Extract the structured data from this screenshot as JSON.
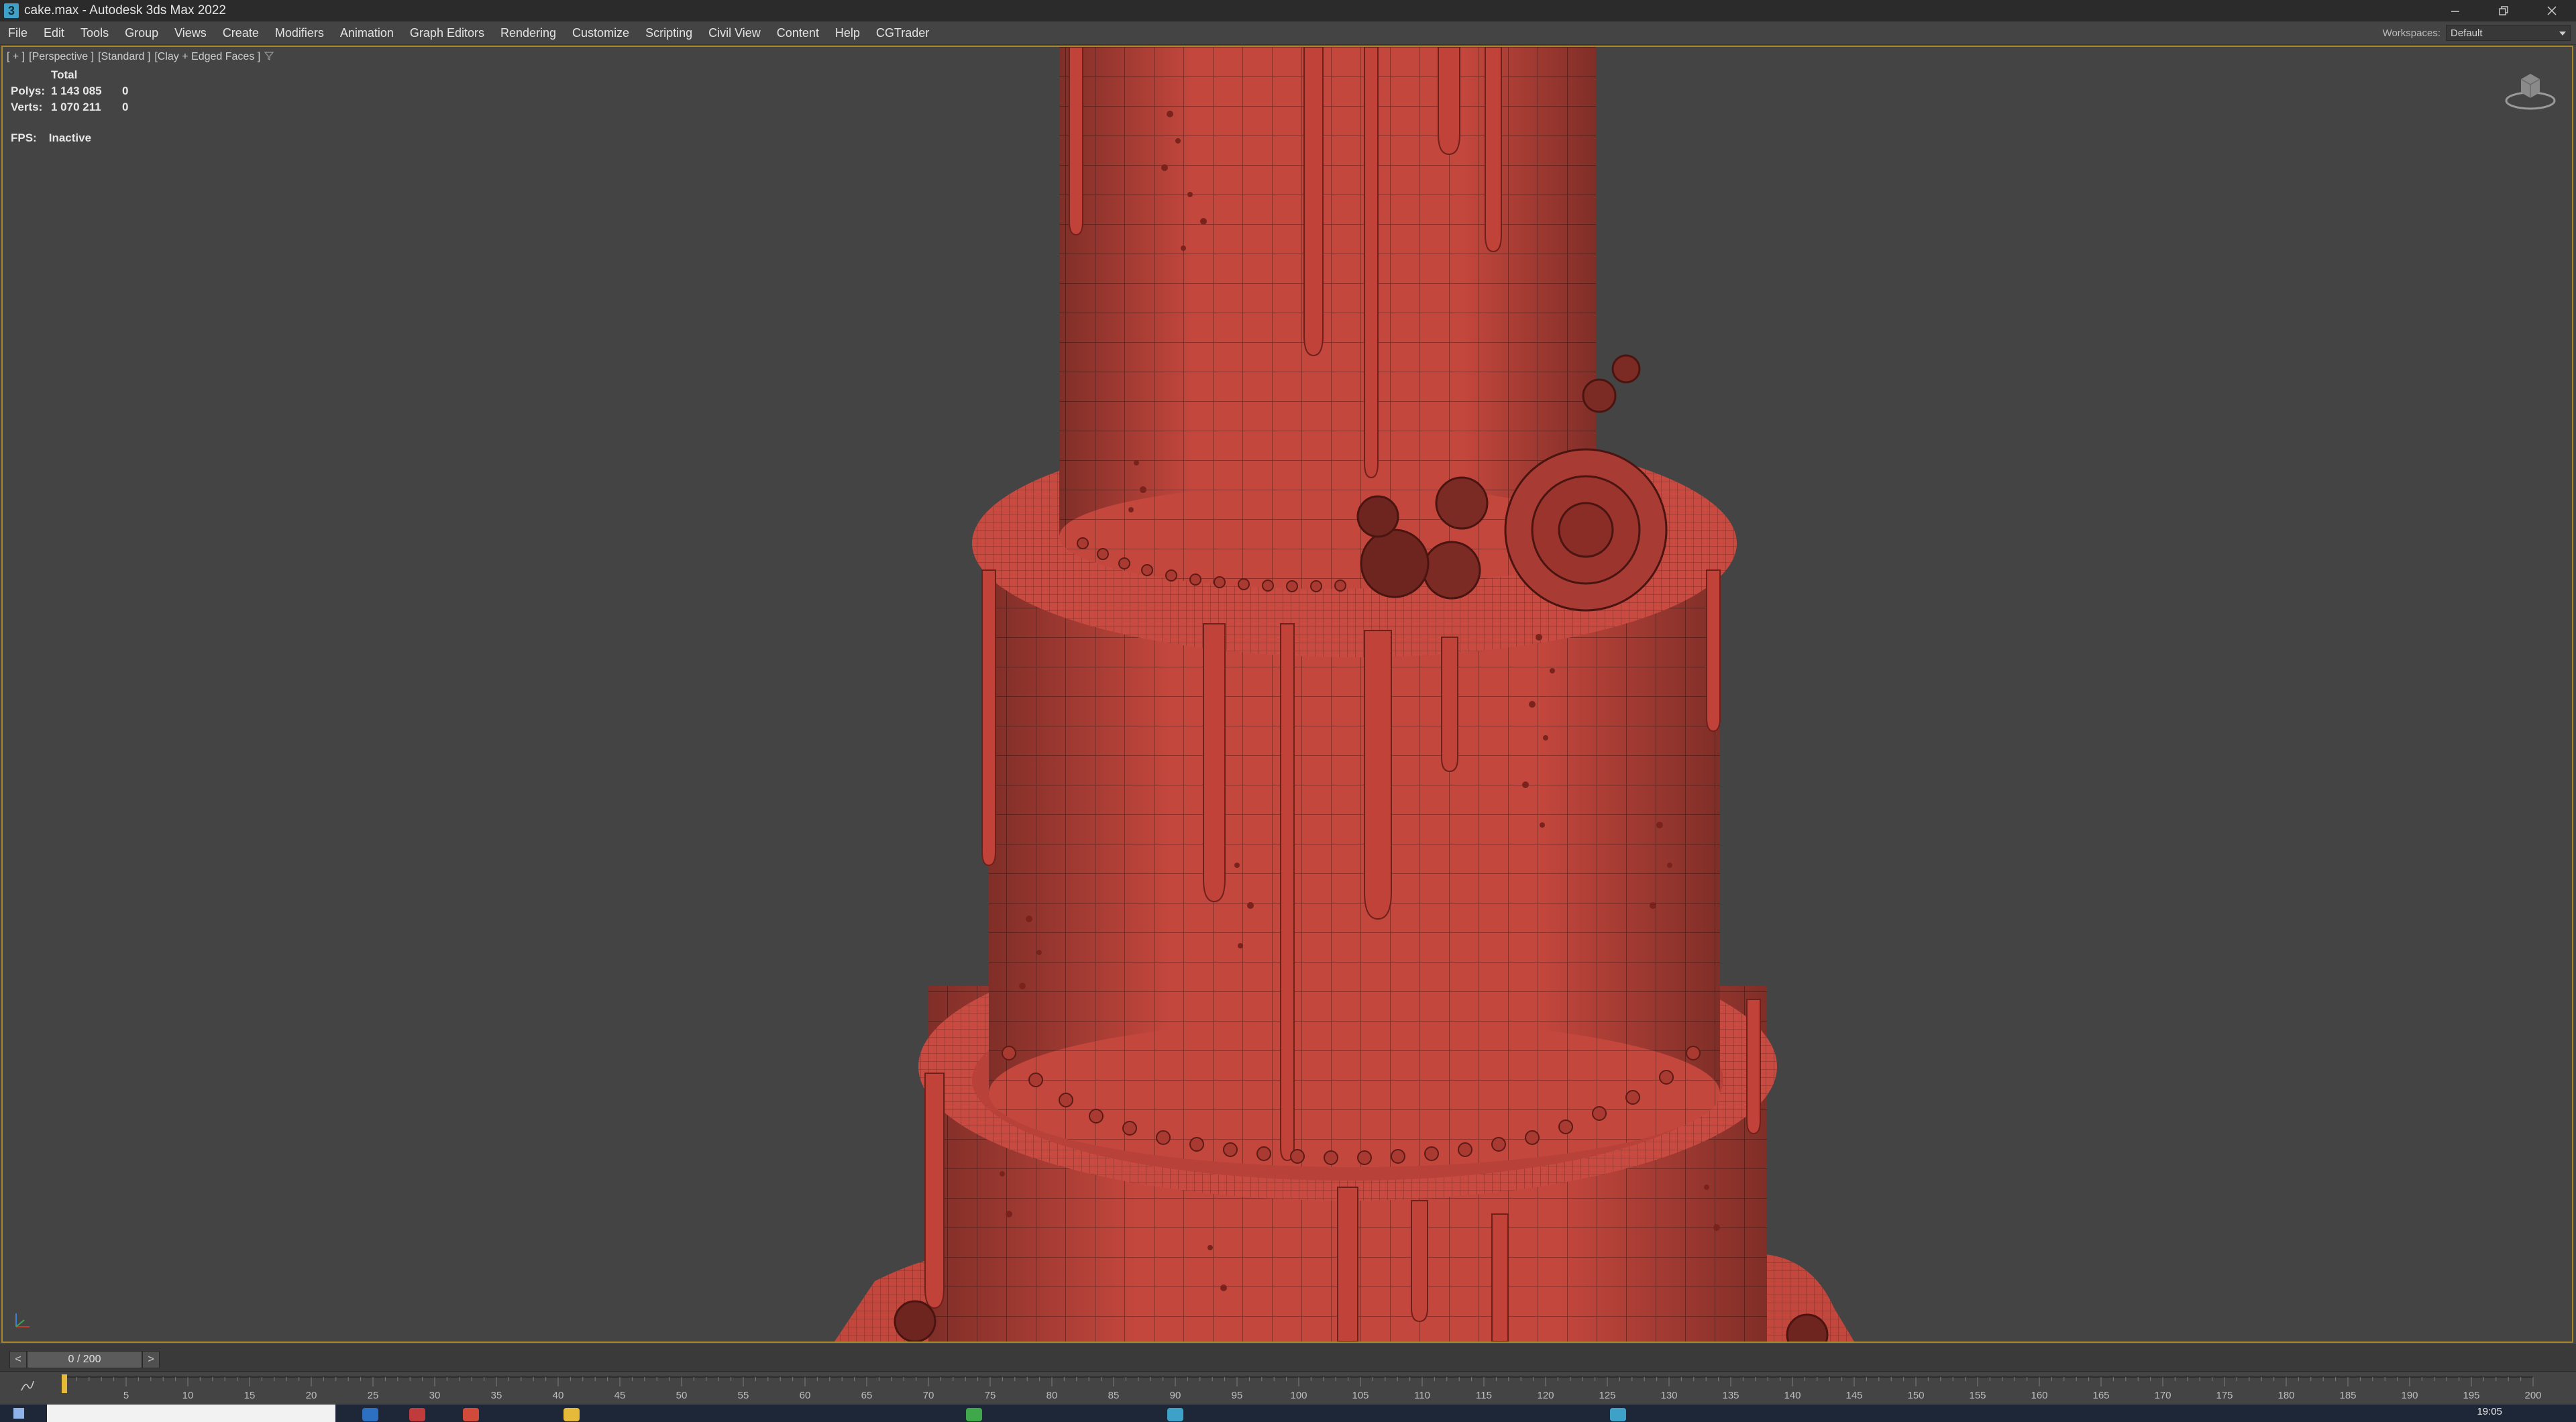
{
  "window": {
    "title": "cake.max - Autodesk 3ds Max 2022",
    "app_icon_glyph": "3",
    "controls": [
      "minimize-icon",
      "restore-icon",
      "close-icon"
    ]
  },
  "menu": {
    "items": [
      "File",
      "Edit",
      "Tools",
      "Group",
      "Views",
      "Create",
      "Modifiers",
      "Animation",
      "Graph Editors",
      "Rendering",
      "Customize",
      "Scripting",
      "Civil View",
      "Content",
      "Help",
      "CGTrader"
    ]
  },
  "workspaces": {
    "label": "Workspaces:",
    "value": "Default"
  },
  "viewport": {
    "labels": [
      "[ + ]",
      "[Perspective ]",
      "[Standard ]",
      "[Clay + Edged Faces ]"
    ],
    "stats": {
      "header": "Total",
      "polys_label": "Polys:",
      "polys_value": "1 143 085",
      "polys_sel": "0",
      "verts_label": "Verts:",
      "verts_value": "1 070 211",
      "verts_sel": "0"
    },
    "fps_label": "FPS:",
    "fps_value": "Inactive",
    "frame_color": "#a8862a",
    "clay_color": "#c4473d"
  },
  "timeslider": {
    "frame": "0 / 200",
    "prev": "<",
    "next": ">"
  },
  "track": {
    "ticks": [
      "5",
      "10",
      "15",
      "20",
      "25",
      "30",
      "35",
      "40",
      "45",
      "50",
      "55",
      "60",
      "65",
      "70",
      "75",
      "80",
      "85",
      "90",
      "95",
      "100",
      "105",
      "110",
      "115",
      "120",
      "125",
      "130",
      "135",
      "140",
      "145",
      "150",
      "155",
      "160",
      "165",
      "170",
      "175",
      "180",
      "185",
      "190",
      "195",
      "200"
    ]
  },
  "taskbar": {
    "time": "19:05"
  }
}
